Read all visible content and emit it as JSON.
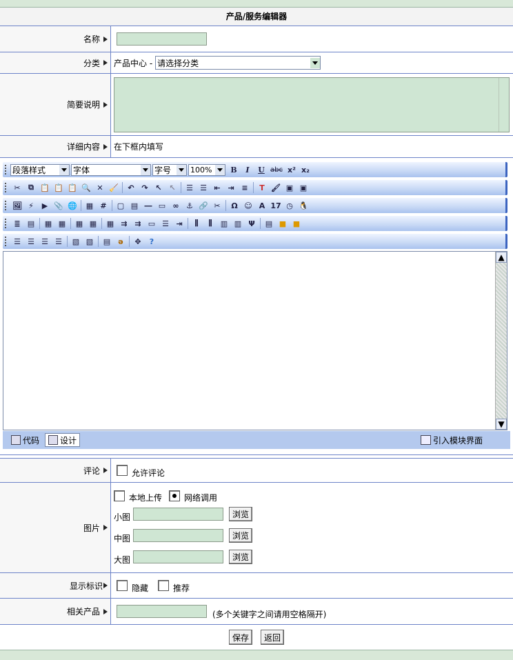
{
  "page": {
    "title": "产品/服务编辑器"
  },
  "form": {
    "name": {
      "label": "名称",
      "value": ""
    },
    "category": {
      "label": "分类",
      "prefix": "产品中心 -",
      "selected": "请选择分类"
    },
    "summary": {
      "label": "简要说明",
      "value": ""
    },
    "detail": {
      "label": "详细内容",
      "hint": "在下框内填写"
    },
    "comment": {
      "label": "评论",
      "checkbox_label": "允许评论"
    },
    "image": {
      "label": "图片",
      "option_local": "本地上传",
      "option_web": "网络调用",
      "small_label": "小图",
      "medium_label": "中图",
      "large_label": "大图",
      "browse_label": "浏览"
    },
    "flags": {
      "label": "显示标识",
      "hidden_label": "隐藏",
      "recommend_label": "推荐"
    },
    "related": {
      "label": "相关产品",
      "hint": "(多个关键字之间请用空格隔开)"
    }
  },
  "editor": {
    "paragraph_style": "段落样式",
    "font": "字体",
    "font_size": "字号",
    "zoom": "100%",
    "tab_code": "代码",
    "tab_design": "设计",
    "import_module": "引入模块界面",
    "fmt": {
      "bold": "B",
      "italic": "I",
      "underline": "U",
      "strike": "abc",
      "sup": "x²",
      "sub": "x₂"
    }
  },
  "actions": {
    "save": "保存",
    "back": "返回"
  }
}
